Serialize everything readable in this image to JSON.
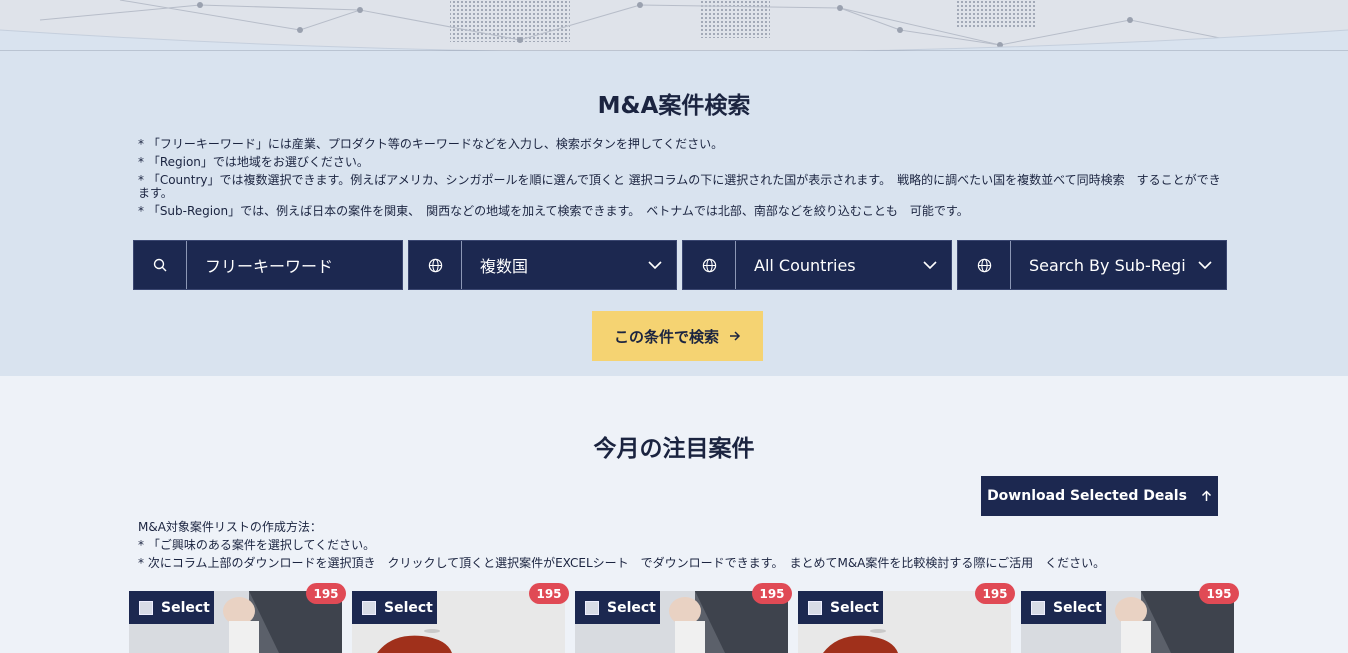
{
  "search": {
    "title": "M&A案件検索",
    "notes": [
      "* 「フリーキーワード」には産業、プロダクト等のキーワードなどを入力し、検索ボタンを押してください。",
      "* 「Region」では地域をお選びください。",
      "* 「Country」では複数選択できます。例えばアメリカ、シンガポールを順に選んで頂くと 選択コラムの下に選択された国が表示されます。　戦略的に調べたい国を複数並べて同時検索　することができます。",
      "* 「Sub-Region」では、例えば日本の案件を関東、　関西などの地域を加えて検索できます。　ベトナムでは北部、南部などを絞り込むことも　可能です。"
    ],
    "keyword_placeholder": "フリーキーワード",
    "region_value": "複数国",
    "country_value": "All Countries",
    "subregion_value": "Search By Sub-Regi",
    "submit_label": "この条件で検索",
    "icons": {
      "search": "search-icon",
      "globe": "globe-icon",
      "chevron": "chevron-down-icon",
      "arrow": "arrow-right-icon"
    }
  },
  "featured": {
    "title": "今月の注目案件",
    "download_label": "Download Selected Deals",
    "howto": [
      "M&A対象案件リストの作成方法：",
      "* 「ご興味のある案件を選択してください。",
      "* 次にコラム上部のダウンロードを選択頂き　クリックして頂くと選択案件がEXCELシート　でダウンロードできます。　まとめてM&A案件を比較検討する際にご活用　ください。"
    ],
    "cards": [
      {
        "select_label": "Select",
        "badge": "195",
        "image": "business-person-photo"
      },
      {
        "select_label": "Select",
        "badge": "195",
        "image": "red-drink-photo"
      },
      {
        "select_label": "Select",
        "badge": "195",
        "image": "business-person-photo"
      },
      {
        "select_label": "Select",
        "badge": "195",
        "image": "red-drink-photo"
      },
      {
        "select_label": "Select",
        "badge": "195",
        "image": "business-person-photo"
      }
    ]
  },
  "colors": {
    "navy": "#1c2850",
    "accent_yellow": "#f5d372",
    "badge_red": "#e04a55",
    "search_bg": "#d9e3ef",
    "page_bg": "#eef2f8"
  }
}
